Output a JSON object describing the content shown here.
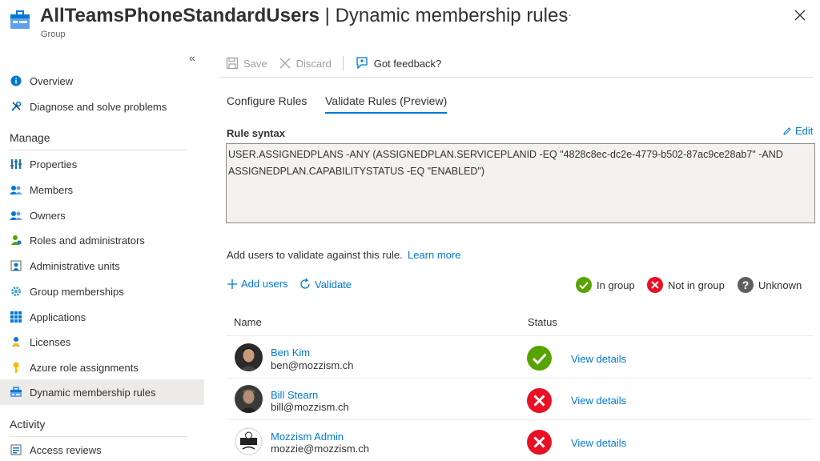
{
  "header": {
    "title_main": "AllTeamsPhoneStandardUsers",
    "title_sep": " | ",
    "title_page": "Dynamic membership rules",
    "subtitle": "Group",
    "more": "···"
  },
  "sidebar": {
    "collapse": "«",
    "items_top": [
      {
        "label": "Overview",
        "icon": "info-icon"
      },
      {
        "label": "Diagnose and solve problems",
        "icon": "wrench-icon"
      }
    ],
    "manage_heading": "Manage",
    "items_manage": [
      {
        "label": "Properties",
        "icon": "properties-icon"
      },
      {
        "label": "Members",
        "icon": "members-icon"
      },
      {
        "label": "Owners",
        "icon": "owners-icon"
      },
      {
        "label": "Roles and administrators",
        "icon": "roles-icon"
      },
      {
        "label": "Administrative units",
        "icon": "admin-units-icon"
      },
      {
        "label": "Group memberships",
        "icon": "gear-icon"
      },
      {
        "label": "Applications",
        "icon": "applications-icon"
      },
      {
        "label": "Licenses",
        "icon": "licenses-icon"
      },
      {
        "label": "Azure role assignments",
        "icon": "key-icon"
      },
      {
        "label": "Dynamic membership rules",
        "icon": "dynamic-rules-icon"
      }
    ],
    "activity_heading": "Activity",
    "items_activity": [
      {
        "label": "Access reviews",
        "icon": "access-reviews-icon"
      }
    ]
  },
  "toolbar": {
    "save": "Save",
    "discard": "Discard",
    "feedback": "Got feedback?"
  },
  "tabs": {
    "configure": "Configure Rules",
    "validate": "Validate Rules (Preview)"
  },
  "rule": {
    "label": "Rule syntax",
    "edit": "Edit",
    "line1": "USER.ASSIGNEDPLANS -ANY (ASSIGNEDPLAN.SERVICEPLANID -EQ \"4828c8ec-dc2e-4779-b502-87ac9ce28ab7\" -AND",
    "line2": "ASSIGNEDPLAN.CAPABILITYSTATUS -EQ \"ENABLED\")"
  },
  "validate": {
    "intro": "Add users to validate against this rule.",
    "learn_more": "Learn more",
    "add_users": "Add users",
    "validate": "Validate"
  },
  "legend": {
    "in_group": "In group",
    "not_in_group": "Not in group",
    "unknown": "Unknown",
    "colors": {
      "in": "#57a300",
      "not": "#e81123",
      "unknown": "#605e5c"
    }
  },
  "table": {
    "col_name": "Name",
    "col_status": "Status",
    "rows": [
      {
        "name": "Ben Kim",
        "email": "ben@mozzism.ch",
        "status": "in-group",
        "details": "View details"
      },
      {
        "name": "Bill Stearn",
        "email": "bill@mozzism.ch",
        "status": "not-in-group",
        "details": "View details"
      },
      {
        "name": "Mozzism Admin",
        "email": "mozzie@mozzism.ch",
        "status": "not-in-group",
        "details": "View details"
      }
    ]
  }
}
